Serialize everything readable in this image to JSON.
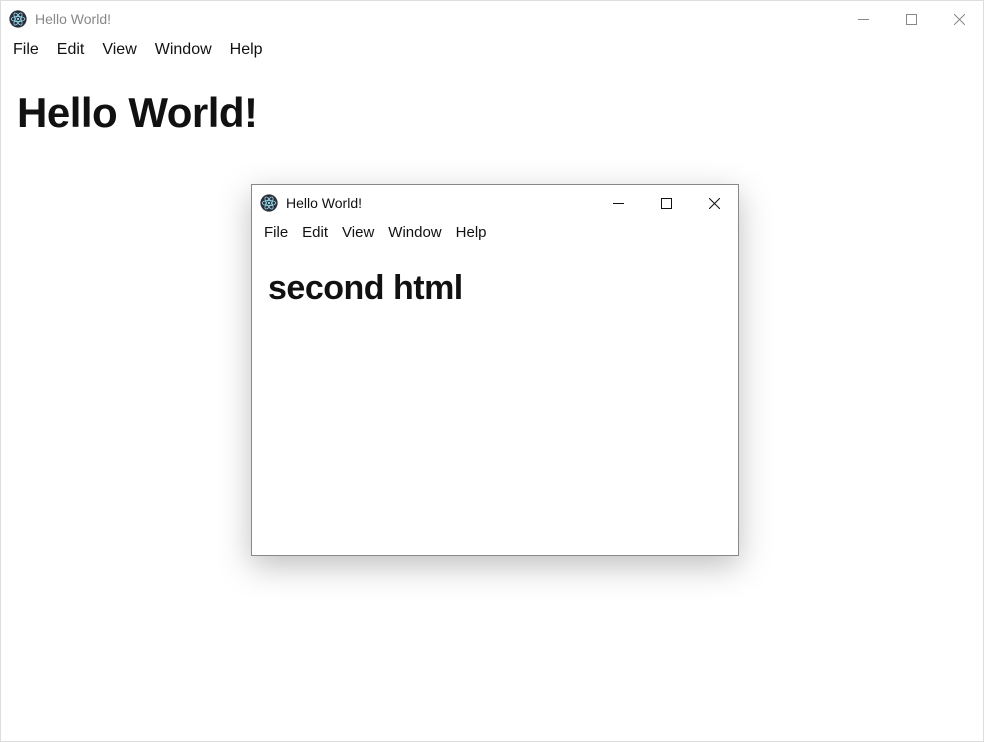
{
  "outer": {
    "title": "Hello World!",
    "menu": {
      "file": "File",
      "edit": "Edit",
      "view": "View",
      "window": "Window",
      "help": "Help"
    },
    "heading": "Hello World!"
  },
  "child": {
    "title": "Hello World!",
    "menu": {
      "file": "File",
      "edit": "Edit",
      "view": "View",
      "window": "Window",
      "help": "Help"
    },
    "heading": "second html"
  }
}
